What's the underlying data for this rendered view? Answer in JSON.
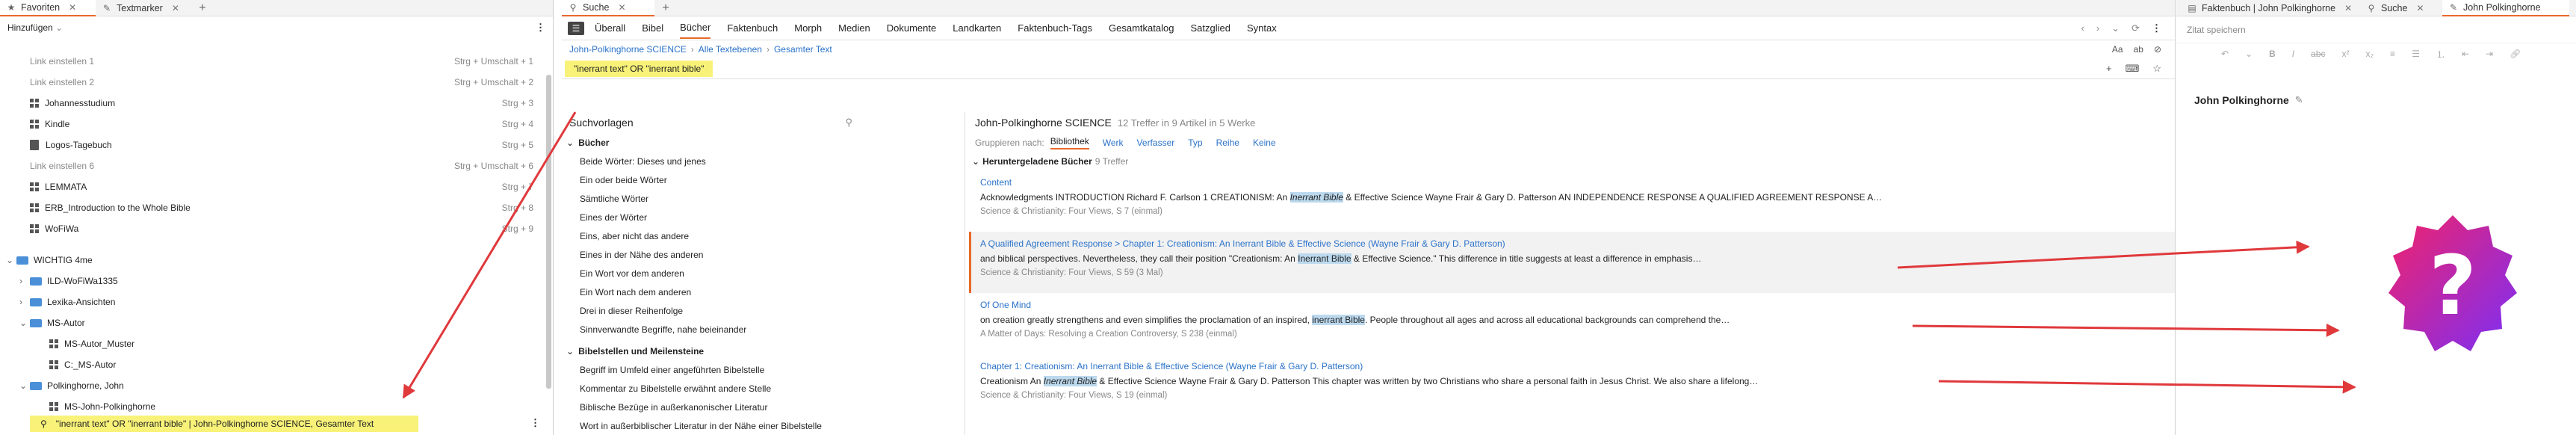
{
  "left_panel": {
    "tabs": [
      {
        "label": "Favoriten",
        "icon": "star-icon"
      },
      {
        "label": "Textmarker",
        "icon": "pencil-icon"
      }
    ],
    "add_label": "Hinzufügen",
    "items": [
      {
        "label": "Link einstellen 1",
        "shortcut": "Strg + Umschalt + 1",
        "kind": "placeholder",
        "indent": 1
      },
      {
        "label": "Link einstellen 2",
        "shortcut": "Strg + Umschalt + 2",
        "kind": "placeholder",
        "indent": 1
      },
      {
        "label": "Johannesstudium",
        "shortcut": "Strg + 3",
        "kind": "layout",
        "indent": 1
      },
      {
        "label": "Kindle",
        "shortcut": "Strg + 4",
        "kind": "layout",
        "indent": 1
      },
      {
        "label": "Logos-Tagebuch",
        "shortcut": "Strg + 5",
        "kind": "book",
        "indent": 1
      },
      {
        "label": "Link einstellen 6",
        "shortcut": "Strg + Umschalt + 6",
        "kind": "placeholder",
        "indent": 1
      },
      {
        "label": "LEMMATA",
        "shortcut": "Strg + 7",
        "kind": "layout",
        "indent": 1
      },
      {
        "label": "ERB_Introduction to the Whole Bible",
        "shortcut": "Strg + 8",
        "kind": "layout",
        "indent": 1
      },
      {
        "label": "WoFiWa",
        "shortcut": "Strg + 9",
        "kind": "layout",
        "indent": 1
      }
    ],
    "folders": [
      {
        "label": "WICHTIG 4me",
        "indent": 0,
        "expanded": true
      },
      {
        "label": "ILD-WoFiWa1335",
        "indent": 1,
        "expanded": false
      },
      {
        "label": "Lexika-Ansichten",
        "indent": 1,
        "expanded": false
      },
      {
        "label": "MS-Autor",
        "indent": 1,
        "expanded": true
      },
      {
        "label": "MS-Autor_Muster",
        "indent": 2,
        "kind": "layout"
      },
      {
        "label": "C:_MS-Autor",
        "indent": 2,
        "kind": "layout"
      },
      {
        "label": "Polkinghorne, John",
        "indent": 1,
        "expanded": true
      },
      {
        "label": "MS-John-Polkinghorne",
        "indent": 2,
        "kind": "layout"
      }
    ],
    "selected_item": "\"inerrant text\" OR \"inerrant bible\" | John-Polkinghorne SCIENCE, Gesamter Text"
  },
  "search_panel": {
    "tabs": [
      {
        "label": "Suche",
        "icon": "search-icon"
      }
    ],
    "nav": [
      "Überall",
      "Bibel",
      "Bücher",
      "Faktenbuch",
      "Morph",
      "Medien",
      "Dokumente",
      "Landkarten",
      "Faktenbuch-Tags",
      "Gesamtkatalog",
      "Satzglied",
      "Syntax"
    ],
    "active_nav": "Bücher",
    "breadcrumb": [
      "John-Polkinghorne SCIENCE",
      "Alle Textebenen",
      "Gesamter Text"
    ],
    "query": "\"inerrant text\" OR \"inerrant bible\"",
    "templates_title": "Suchvorlagen",
    "template_groups": [
      {
        "title": "Bücher",
        "items": [
          "Beide Wörter: Dieses und jenes",
          "Ein oder beide Wörter",
          "Sämtliche Wörter",
          "Eines der Wörter",
          "Eins, aber nicht das andere",
          "Eines in der Nähe des anderen",
          "Ein Wort vor dem anderen",
          "Ein Wort nach dem anderen",
          "Drei in dieser Reihenfolge",
          "Sinnverwandte Begriffe, nahe beieinander"
        ]
      },
      {
        "title": "Bibelstellen und Meilensteine",
        "items": [
          "Begriff im Umfeld einer angeführten Bibelstelle",
          "Kommentar zu Bibelstelle erwähnt andere Stelle",
          "Biblische Bezüge in außerkanonischer Literatur",
          "Wort in außerbiblischer Literatur in der Nähe einer Bibelstelle"
        ]
      }
    ],
    "results": {
      "title": "John-Polkinghorne SCIENCE",
      "summary": "12 Treffer in 9 Artikel in 5 Werke",
      "group_label": "Gruppieren nach:",
      "group_options": [
        "Bibliothek",
        "Werk",
        "Verfasser",
        "Typ",
        "Reihe",
        "Keine"
      ],
      "active_group": "Bibliothek",
      "section": "Heruntergeladene Bücher",
      "section_count": "9 Treffer",
      "entries": [
        {
          "title": "Content",
          "pre": "Acknowledgments INTRODUCTION Richard F. Carlson 1 CREATIONISM: An ",
          "hit": "Inerrant Bible",
          "post": " & Effective Science Wayne Frair & Gary D. Patterson AN INDEPENDENCE RESPONSE A QUALIFIED AGREEMENT RESPONSE A…",
          "source": "Science & Christianity: Four Views, S 7 (einmal)",
          "selected": false,
          "italic_hit": true
        },
        {
          "title": "A Qualified Agreement Response > Chapter 1: Creationism: An Inerrant Bible & Effective Science (Wayne Frair & Gary D. Patterson)",
          "pre": "and biblical perspectives. Nevertheless, they call their position \"Creationism: An ",
          "hit": "Inerrant Bible",
          "post": " & Effective Science.\" This difference in title suggests at least a difference in emphasis…",
          "source": "Science & Christianity: Four Views, S 59 (3 Mal)",
          "selected": true,
          "italic_hit": false
        },
        {
          "title": "Of One Mind",
          "pre": "on creation greatly strengthens and even simplifies the proclamation of an inspired, ",
          "hit": "inerrant Bible",
          "post": ". People throughout all ages and across all educational backgrounds can comprehend the…",
          "source": "A Matter of Days: Resolving a Creation Controversy, S 238 (einmal)",
          "selected": false,
          "italic_hit": false
        },
        {
          "title": "Chapter 1: Creationism: An Inerrant Bible & Effective Science (Wayne Frair & Gary D. Patterson)",
          "pre": "Creationism An ",
          "hit": "Inerrant Bible",
          "post": " & Effective Science Wayne Frair & Gary D. Patterson This chapter was written by two Christians who share a personal faith in Jesus Christ. We also share a lifelong…",
          "source": "Science & Christianity: Four Views, S 19 (einmal)",
          "selected": false,
          "italic_hit": true
        }
      ]
    }
  },
  "right_panel": {
    "tabs": [
      {
        "label": "Faktenbuch | John Polkinghorne",
        "icon": "doc-icon"
      },
      {
        "label": "Suche",
        "icon": "search-icon"
      },
      {
        "label": "John Polkinghorne",
        "icon": "pencil-icon"
      }
    ],
    "quote_placeholder": "Zitat speichern",
    "note_title": "John Polkinghorne",
    "colors": {
      "accent": "#e8692a",
      "arrow": "#e0393c",
      "badge_start": "#f2226a",
      "badge_end": "#7b2ff7",
      "highlight": "#f8f279"
    }
  }
}
